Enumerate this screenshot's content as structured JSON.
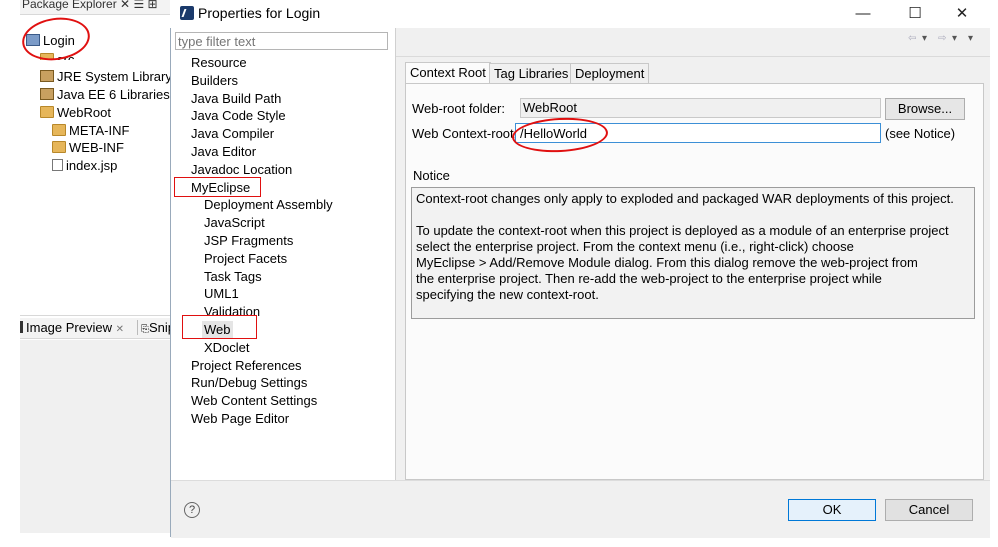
{
  "workbench": {
    "explorer_tab": "Package Explorer ✕  ☰ ⊞",
    "tree": [
      {
        "label": "Login",
        "icon": "project-icon"
      },
      {
        "label": "src",
        "icon": "folder-icon"
      },
      {
        "label": "JRE System Library [j",
        "icon": "library-icon"
      },
      {
        "label": "Java EE 6 Libraries",
        "icon": "library-icon"
      },
      {
        "label": "WebRoot",
        "icon": "folder-icon"
      },
      {
        "label": "META-INF",
        "icon": "folder-icon"
      },
      {
        "label": "WEB-INF",
        "icon": "folder-icon"
      },
      {
        "label": "index.jsp",
        "icon": "file-icon"
      }
    ],
    "lower_tabs": {
      "image_preview": "Image Preview",
      "snippets": "Snip"
    }
  },
  "dialog": {
    "title": "Properties for Login",
    "window_controls": {
      "minimize": "—",
      "maximize": "☐",
      "close": "✕"
    },
    "filter_placeholder": "type filter text",
    "nav": [
      {
        "label": "Resource",
        "level": 1
      },
      {
        "label": "Builders",
        "level": 1
      },
      {
        "label": "Java Build Path",
        "level": 1
      },
      {
        "label": "Java Code Style",
        "level": 1
      },
      {
        "label": "Java Compiler",
        "level": 1
      },
      {
        "label": "Java Editor",
        "level": 1
      },
      {
        "label": "Javadoc Location",
        "level": 1
      },
      {
        "label": "MyEclipse",
        "level": 1
      },
      {
        "label": "Deployment Assembly",
        "level": 2
      },
      {
        "label": "JavaScript",
        "level": 2
      },
      {
        "label": "JSP Fragments",
        "level": 2
      },
      {
        "label": "Project Facets",
        "level": 2
      },
      {
        "label": "Task Tags",
        "level": 2
      },
      {
        "label": "UML1",
        "level": 2
      },
      {
        "label": "Validation",
        "level": 2
      },
      {
        "label": "Web",
        "level": 2,
        "selected": true
      },
      {
        "label": "XDoclet",
        "level": 2
      },
      {
        "label": "Project References",
        "level": 1
      },
      {
        "label": "Run/Debug Settings",
        "level": 1
      },
      {
        "label": "Web Content Settings",
        "level": 1
      },
      {
        "label": "Web Page Editor",
        "level": 1
      }
    ],
    "toolbar": {
      "back": "⇦",
      "back_menu": "▾",
      "forward": "⇨",
      "forward_menu": "▾",
      "view_menu": "▾"
    },
    "tabs": [
      {
        "label": "Context Root",
        "active": true
      },
      {
        "label": "Tag Libraries",
        "active": false
      },
      {
        "label": "Deployment",
        "active": false
      }
    ],
    "web_root": {
      "label": "Web-root folder:",
      "value": "WebRoot",
      "browse": "Browse..."
    },
    "context_root": {
      "label": "Web Context-root:",
      "value": "/HelloWorld",
      "hint": "(see Notice)"
    },
    "notice": {
      "label": "Notice",
      "para1": "Context-root changes only apply to exploded and packaged WAR deployments of this project.",
      "para2_lines": [
        "To update the context-root when this project is deployed as a module of an enterprise project",
        "select the enterprise project. From the context menu (i.e., right-click) choose",
        "MyEclipse > Add/Remove Module dialog. From this dialog remove the web-project from",
        "the enterprise project. Then re-add the web-project to the enterprise project while",
        "specifying the new context-root."
      ]
    },
    "help": "?",
    "ok": "OK",
    "cancel": "Cancel"
  },
  "annotation_color": "#e01010"
}
